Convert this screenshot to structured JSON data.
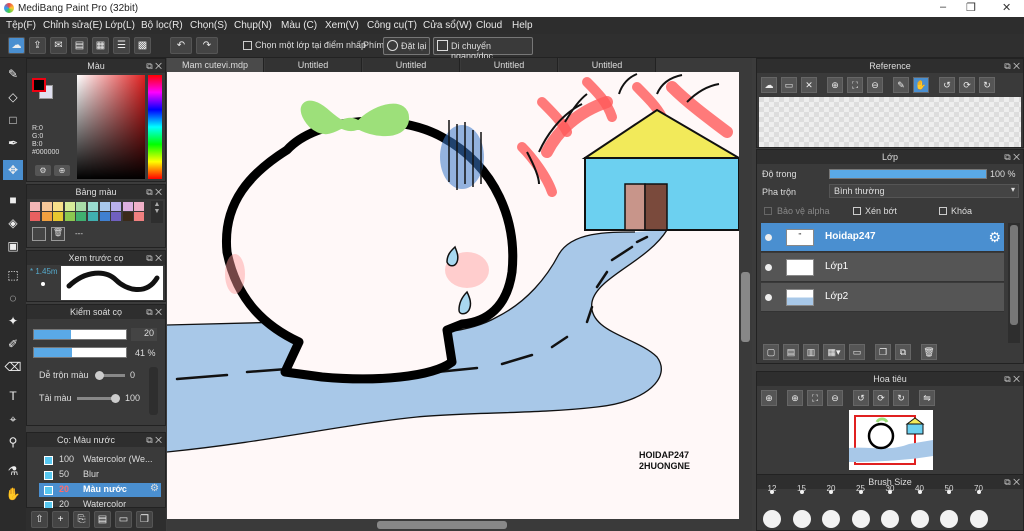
{
  "window": {
    "title": "MediBang Paint Pro (32bit)",
    "controls": [
      "–",
      "❐",
      "✕"
    ]
  },
  "menu": [
    "Tệp(F)",
    "Chỉnh sửa(E)",
    "Lớp(L)",
    "Bộ lọc(R)",
    "Chọn(S)",
    "Chụp(N)",
    "Màu (C)",
    "Xem(V)",
    "Công cụ(T)",
    "Cửa sổ(W)",
    "Cloud",
    "Help"
  ],
  "toolbar": {
    "checkbox_label": "Chọn một lớp tại điểm nhấp",
    "phim_label": "Phím",
    "reset_label": "Đặt lại",
    "flip_label": "Di chuyển ngang/dọc"
  },
  "color_panel": {
    "title": "Màu",
    "r": "R:0",
    "g": "G:0",
    "b": "B:0",
    "hex": "#000000"
  },
  "palette_panel": {
    "title": "Bảng màu",
    "menu_label": "---"
  },
  "brush_preview": {
    "title": "Xem trước cọ",
    "size": "* 1.45m"
  },
  "brush_control": {
    "title": "Kiểm soát cọ",
    "size_value": "20",
    "opacity_value": "41 %",
    "blend_label": "Dễ trộn màu",
    "blend_value": "0",
    "paint_label": "Tải màu",
    "paint_value": "100"
  },
  "brush_list": {
    "title": "Cọ: Màu nước",
    "items": [
      {
        "size": "100",
        "name": "Watercolor (We...",
        "color": "#58c8f0"
      },
      {
        "size": "50",
        "name": "Blur",
        "color": "#58c8f0"
      },
      {
        "size": "20",
        "name": "Màu nước",
        "color": "#58c8f0",
        "selected": true
      },
      {
        "size": "20",
        "name": "Watercolor",
        "color": "#58c8f0"
      }
    ]
  },
  "doc_tabs": [
    "Mam cutevi.mdp",
    "Untitled",
    "Untitled",
    "Untitled",
    "Untitled"
  ],
  "canvas": {
    "signature_line1": "HOIDAP247",
    "signature_line2": "2HUONGNE"
  },
  "reference": {
    "title": "Reference"
  },
  "layer_panel": {
    "title": "Lớp",
    "opacity_label": "Độ trong",
    "opacity_value": "100 %",
    "opacity_fraction": 1.0,
    "blend_label": "Pha trộn",
    "blend_value": "Bình thường",
    "protect_alpha": "Bảo vệ alpha",
    "clipping": "Xén bớt",
    "lock": "Khóa",
    "layers": [
      {
        "name": "Hoidap247",
        "selected": true
      },
      {
        "name": "Lớp1",
        "selected": false
      },
      {
        "name": "Lớp2",
        "selected": false
      }
    ]
  },
  "navigator": {
    "title": "Hoa tiêu"
  },
  "brush_size": {
    "title": "Brush Size",
    "sizes": [
      "12",
      "15",
      "20",
      "25",
      "30",
      "40",
      "50",
      "70"
    ]
  }
}
